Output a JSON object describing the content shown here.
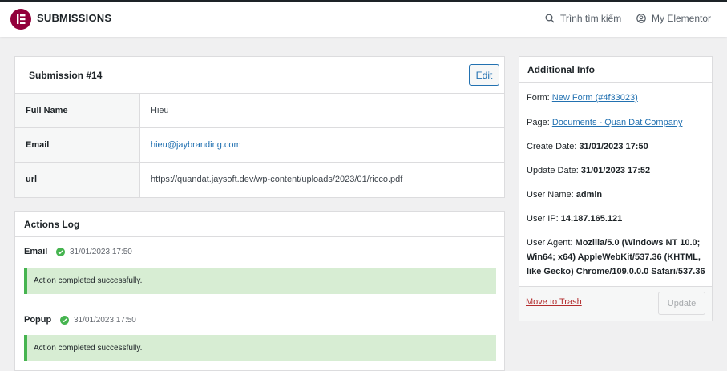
{
  "header": {
    "brand": "SUBMISSIONS",
    "search_label": "Trình tìm kiếm",
    "account_label": "My Elementor"
  },
  "submission": {
    "title": "Submission #14",
    "edit_label": "Edit",
    "fields": [
      {
        "label": "Full Name",
        "value": "Hieu"
      },
      {
        "label": "Email",
        "value": "hieu@jaybranding.com"
      },
      {
        "label": "url",
        "value": "https://quandat.jaysoft.dev/wp-content/uploads/2023/01/ricco.pdf"
      }
    ]
  },
  "actions_log": {
    "title": "Actions Log",
    "items": [
      {
        "name": "Email",
        "date": "31/01/2023 17:50",
        "message": "Action completed successfully."
      },
      {
        "name": "Popup",
        "date": "31/01/2023 17:50",
        "message": "Action completed successfully."
      }
    ]
  },
  "info": {
    "title": "Additional Info",
    "form_label": "Form:",
    "form_value": "New Form (#4f33023)",
    "page_label": "Page:",
    "page_value": "Documents - Quan Dat Company",
    "create_label": "Create Date:",
    "create_value": "31/01/2023 17:50",
    "update_label": "Update Date:",
    "update_value": "31/01/2023 17:52",
    "user_label": "User Name:",
    "user_value": "admin",
    "ip_label": "User IP:",
    "ip_value": "14.187.165.121",
    "agent_label": "User Agent:",
    "agent_value": "Mozilla/5.0 (Windows NT 10.0; Win64; x64) AppleWebKit/537.36 (KHTML, like Gecko) Chrome/109.0.0.0 Safari/537.36",
    "trash_label": "Move to Trash",
    "update_button": "Update"
  },
  "colors": {
    "brand": "#92003b",
    "link": "#2271b1",
    "success": "#46b450",
    "success_bg": "#d7edd3",
    "danger": "#b32d2e"
  },
  "icons": {
    "logo": "elementor-logo-icon",
    "search": "search-icon",
    "account": "user-circle-icon",
    "status": "check-circle-icon"
  }
}
